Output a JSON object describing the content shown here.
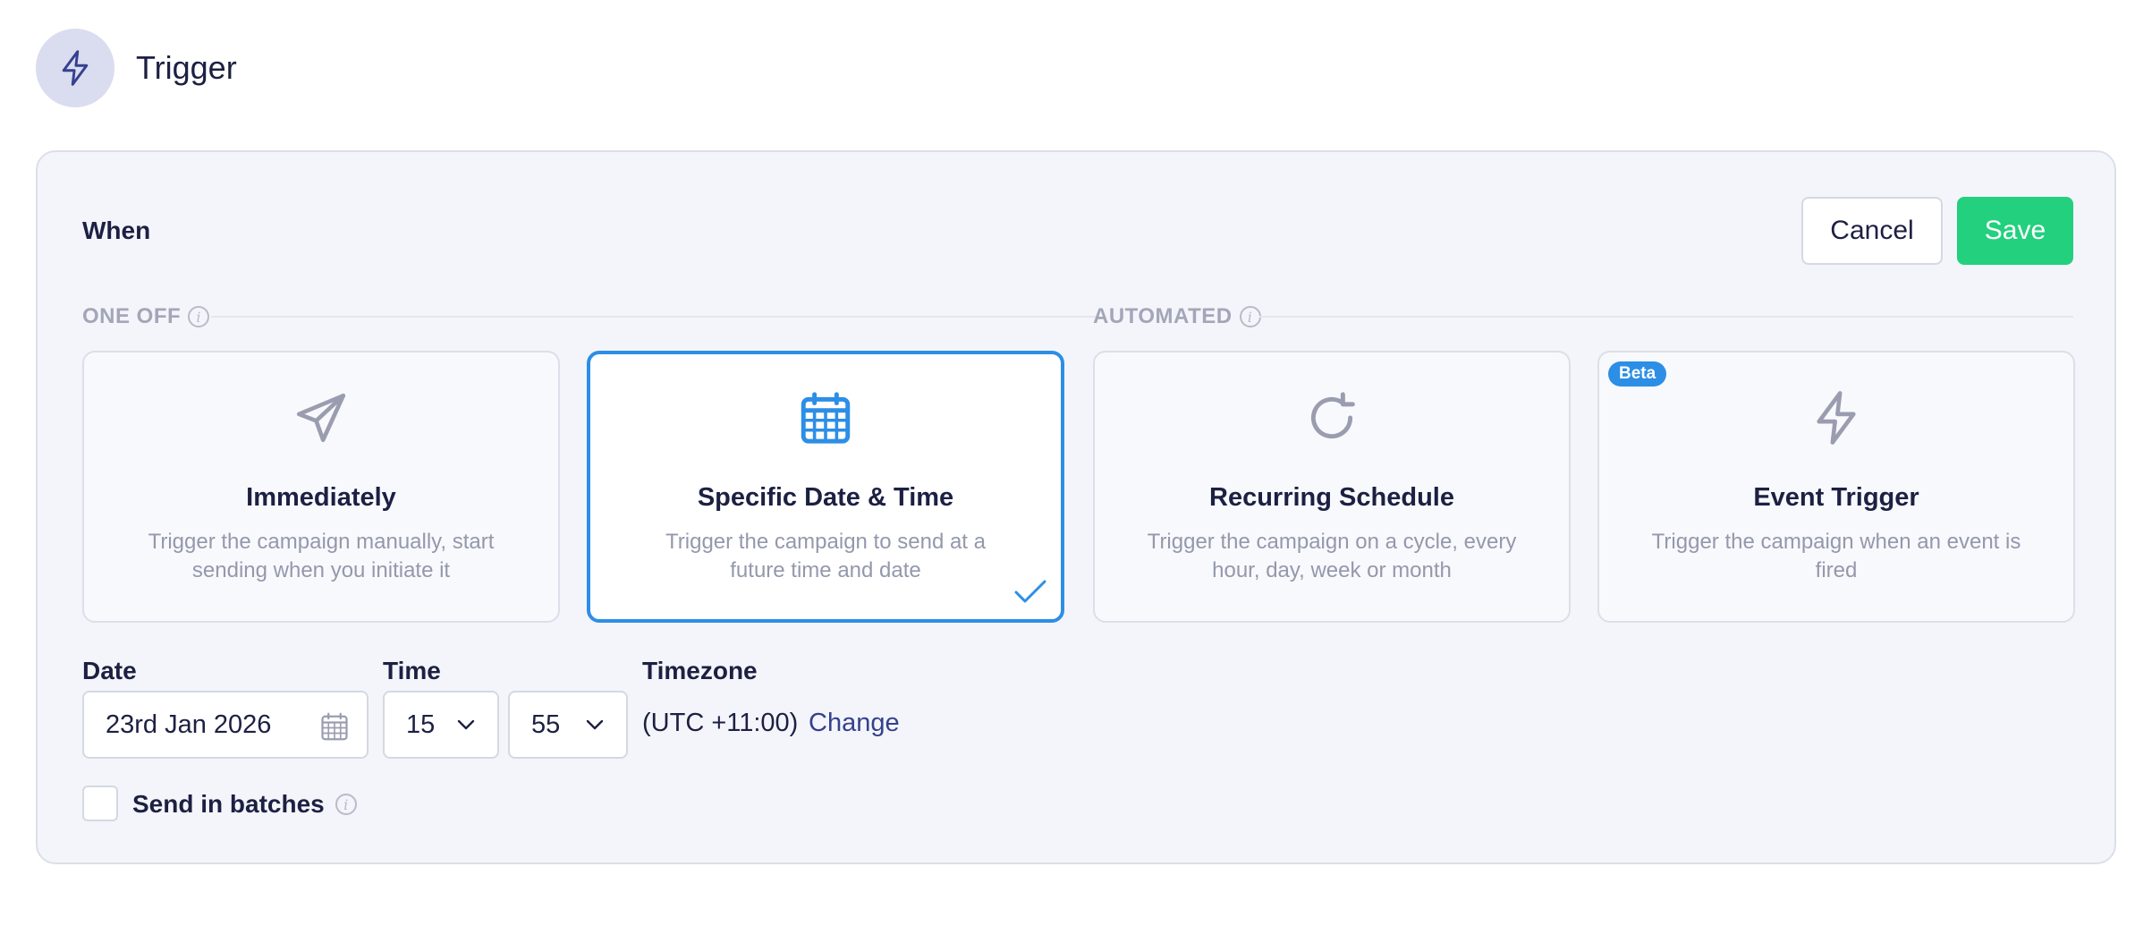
{
  "header": {
    "title": "Trigger",
    "icon": "lightning-icon"
  },
  "panel": {
    "when_label": "When",
    "cancel_label": "Cancel",
    "save_label": "Save",
    "sections": {
      "one_off": "ONE OFF",
      "automated": "AUTOMATED"
    },
    "options": [
      {
        "title": "Immediately",
        "description": "Trigger the campaign manually, start sending when you initiate it",
        "icon": "paper-plane-icon",
        "selected": false
      },
      {
        "title": "Specific Date & Time",
        "description": "Trigger the campaign to send at a future time and date",
        "icon": "calendar-icon",
        "selected": true
      },
      {
        "title": "Recurring Schedule",
        "description": "Trigger the campaign on a cycle, every hour, day, week or month",
        "icon": "refresh-icon",
        "selected": false
      },
      {
        "title": "Event Trigger",
        "description": "Trigger the campaign when an event is fired",
        "icon": "lightning-icon",
        "selected": false,
        "badge": "Beta"
      }
    ],
    "schedule": {
      "date_label": "Date",
      "date_value": "23rd Jan 2026",
      "time_label": "Time",
      "hour_value": "15",
      "minute_value": "55",
      "timezone_label": "Timezone",
      "timezone_value": "(UTC +11:00)",
      "timezone_change": "Change"
    },
    "batches_label": "Send in batches",
    "batches_checked": false
  },
  "colors": {
    "accent_blue": "#2d8ee6",
    "save_green": "#22d07e",
    "text_dark": "#1c2042",
    "text_muted": "#9498ac",
    "link": "#34418f"
  }
}
